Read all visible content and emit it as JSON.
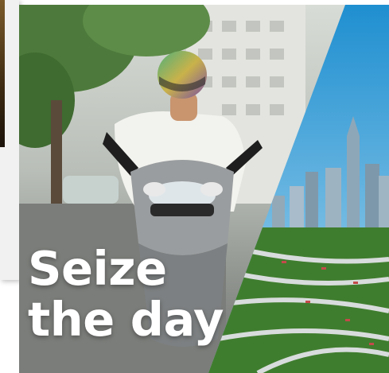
{
  "headline": {
    "line1": "Seize",
    "line2": "the day"
  },
  "colors": {
    "sky": "#2f9bd6",
    "foliage": "#3f7d2e",
    "headline_text": "#ffffff"
  }
}
